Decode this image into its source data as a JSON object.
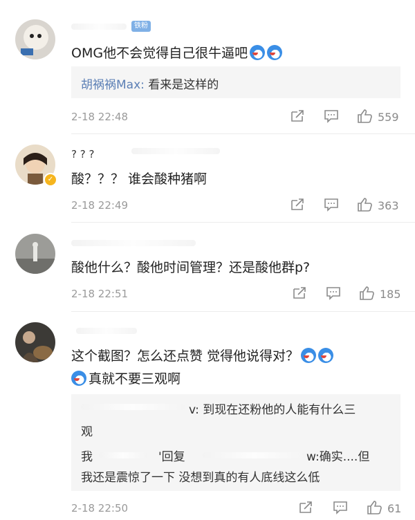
{
  "comments": [
    {
      "fan_badge": "铁粉",
      "text": "OMG他不会觉得自己很牛逼吧",
      "reply": {
        "user": "胡祸祸Max",
        "text": "看来是这样的"
      },
      "time": "2-18 22:48",
      "likes": "559"
    },
    {
      "name_fragment": "? ? ?",
      "text": "酸？？？ 谁会酸种猪啊",
      "time": "2-18 22:49",
      "likes": "363"
    },
    {
      "text": "酸他什么？酸他时间管理？还是酸他群p?",
      "time": "2-18 22:51",
      "likes": "185"
    },
    {
      "text_line1": "这个截图？怎么还点赞 觉得他说得对？",
      "text_line2": "真就不要三观啊",
      "reply": {
        "line1_suffix": "v: 到现在还粉他的人能有什么三",
        "line2": "观",
        "line3_a": "我",
        "line3_b": "'回复",
        "line3_c": "w:确实....但",
        "line4": "我还是震惊了一下 没想到真的有人底线这么低"
      },
      "time": "2-18 22:50",
      "likes": "61"
    }
  ],
  "colors": {
    "accent": "#5b7fb5",
    "muted": "#9a9a9a",
    "reply_bg": "#f5f5f5"
  },
  "icons": [
    "share-icon",
    "comment-icon",
    "like-icon",
    "emoji-laugh-icon"
  ]
}
